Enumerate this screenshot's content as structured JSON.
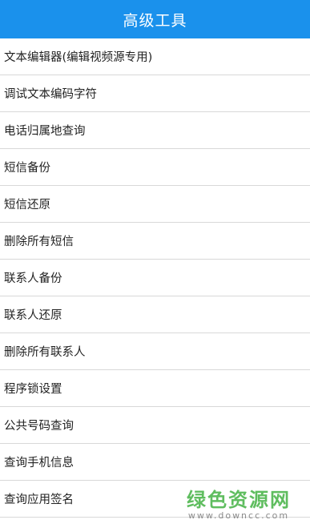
{
  "header": {
    "title": "高级工具"
  },
  "menu": {
    "items": [
      {
        "label": "文本编辑器(编辑视频源专用)"
      },
      {
        "label": "调试文本编码字符"
      },
      {
        "label": "电话归属地查询"
      },
      {
        "label": "短信备份"
      },
      {
        "label": "短信还原"
      },
      {
        "label": "删除所有短信"
      },
      {
        "label": "联系人备份"
      },
      {
        "label": "联系人还原"
      },
      {
        "label": "删除所有联系人"
      },
      {
        "label": "程序锁设置"
      },
      {
        "label": "公共号码查询"
      },
      {
        "label": "查询手机信息"
      },
      {
        "label": "查询应用签名"
      }
    ]
  },
  "watermark": {
    "main": "绿色资源网",
    "sub": "www.downcc.com"
  },
  "colors": {
    "header_bg": "#1a91ec",
    "divider": "#d8d8d8",
    "watermark_green": "#3caf3c"
  }
}
